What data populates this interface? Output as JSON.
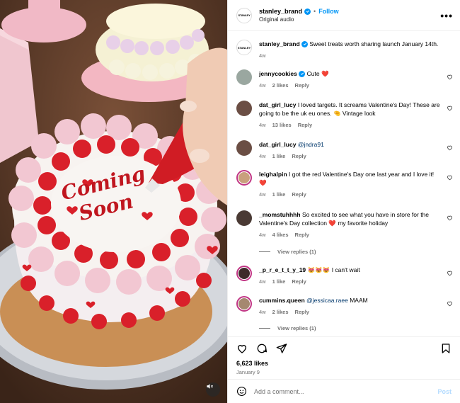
{
  "header": {
    "brand_avatar_text": "STANLEY",
    "username": "stanley_brand",
    "separator": "•",
    "follow_label": "Follow",
    "audio_label": "Original audio",
    "more_label": "•••"
  },
  "caption": {
    "username": "stanley_brand",
    "text": "Sweet treats worth sharing launch January 14th.",
    "time": "4w"
  },
  "cake_text": {
    "line1": "Coming",
    "line2": "Soon"
  },
  "comments": [
    {
      "username": "jennycookies",
      "verified": true,
      "text": "Cute",
      "emoji": "❤️",
      "time": "4w",
      "likes": "2 likes",
      "reply": "Reply",
      "avatar_color": "#9aa7a0"
    },
    {
      "username": "dat_girl_lucy",
      "verified": false,
      "text": "I loved targets. It screams Valentine's Day! These are going to be the uk eu ones.",
      "emoji": "🤏",
      "text_after": "Vintage look",
      "time": "4w",
      "likes": "13 likes",
      "reply": "Reply",
      "avatar_color": "#6b4e44"
    },
    {
      "username": "dat_girl_lucy",
      "verified": false,
      "mention": "@jndra91",
      "time": "4w",
      "likes": "1 like",
      "reply": "Reply",
      "avatar_color": "#6b4e44"
    },
    {
      "username": "leighalpin",
      "verified": false,
      "text": "I got the red Valentine's Day one last year and I love it!",
      "emoji": "❤️",
      "time": "4w",
      "likes": "1 like",
      "reply": "Reply",
      "avatar_color": "#c9a07d"
    },
    {
      "username": "_momstuhhhh",
      "verified": false,
      "text": "So excited to see what you have in store for the Valentine's Day collection",
      "emoji": "❤️",
      "text_after": "my favorite holiday",
      "time": "4w",
      "likes": "4 likes",
      "reply": "Reply",
      "avatar_color": "#4a3a34"
    },
    {
      "username": "_p_r_e_t_t_y_19",
      "verified": false,
      "emoji": "😻😻😻",
      "text": "I can't wait",
      "time": "4w",
      "likes": "1 like",
      "reply": "Reply",
      "avatar_color": "#3e2a2a"
    },
    {
      "username": "cummins.queen",
      "verified": false,
      "mention": "@jessicaa.raee",
      "text": "MAAM",
      "time": "4w",
      "likes": "2 likes",
      "reply": "Reply",
      "avatar_color": "#a58870"
    }
  ],
  "view_replies": [
    {
      "label": "View replies (1)"
    },
    {
      "label": "View replies (1)"
    }
  ],
  "actions": {
    "likes": "6,623 likes",
    "date": "January 9"
  },
  "add_comment": {
    "placeholder": "Add a comment...",
    "post_label": "Post"
  },
  "colors": {
    "accent": "#0095f6",
    "frosting_red": "#d9202a",
    "frosting_pink": "#f3c9d6"
  }
}
